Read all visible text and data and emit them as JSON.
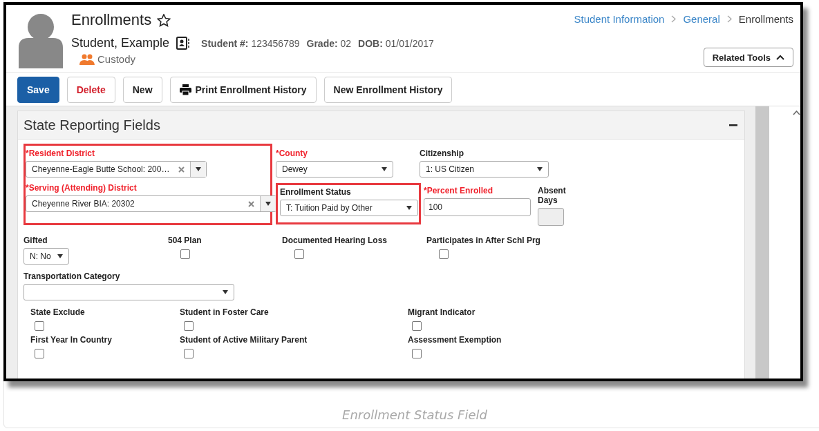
{
  "header": {
    "title": "Enrollments",
    "student_name": "Student, Example",
    "student_number_label": "Student #:",
    "student_number": "123456789",
    "grade_label": "Grade:",
    "grade": "02",
    "dob_label": "DOB:",
    "dob": "01/01/2017",
    "custody": "Custody"
  },
  "breadcrumb": [
    {
      "label": "Student Information",
      "kind": "link"
    },
    {
      "label": "General",
      "kind": "link"
    },
    {
      "label": "Enrollments",
      "kind": "current"
    }
  ],
  "related_tools": {
    "label": "Related Tools",
    "expanded": true
  },
  "toolbar": [
    {
      "label": "Save",
      "kind": "primary"
    },
    {
      "label": "Delete",
      "kind": "danger"
    },
    {
      "label": "New",
      "kind": "plain"
    },
    {
      "label": "Print Enrollment History",
      "kind": "print"
    },
    {
      "label": "New Enrollment History",
      "kind": "plain"
    }
  ],
  "panel": {
    "title": "State Reporting Fields",
    "district_group": {
      "highlighted": true,
      "fields": [
        {
          "label": "*Resident District",
          "required": true,
          "kind": "select",
          "value": "Cheyenne-Eagle Butte School: 200…",
          "clearable": true
        },
        {
          "label": "*Serving (Attending) District",
          "required": true,
          "kind": "select",
          "value": "Cheyenne River BIA: 20302",
          "clearable": true
        }
      ]
    },
    "county": {
      "label": "*County",
      "required": true,
      "kind": "select",
      "value": "Dewey",
      "clearable": false
    },
    "enrollment_status": {
      "label": "Enrollment Status",
      "required": false,
      "kind": "select",
      "value": "T: Tuition Paid by Other",
      "clearable": false,
      "highlighted": true
    },
    "citizenship": {
      "label": "Citizenship",
      "required": false,
      "kind": "select",
      "value": "1: US Citizen",
      "clearable": false
    },
    "percent_enrolled": {
      "label": "*Percent Enrolled",
      "required": true,
      "kind": "text",
      "value": "100",
      "disabled": false
    },
    "absent_days": {
      "label": "Absent Days",
      "required": false,
      "kind": "text",
      "disabled": true
    },
    "row_fields": [
      {
        "label": "Gifted",
        "kind": "select",
        "value": "N: No"
      },
      {
        "label": "504 Plan",
        "kind": "checkbox",
        "checked": false
      },
      {
        "label": "Documented Hearing Loss",
        "kind": "checkbox",
        "checked": false
      },
      {
        "label": "Participates in After Schl Prg",
        "kind": "checkbox",
        "checked": false
      }
    ],
    "transportation_category": {
      "label": "Transportation Category",
      "kind": "select"
    },
    "checkboxes": [
      {
        "label": "State Exclude",
        "checked": false
      },
      {
        "label": "Student in Foster Care",
        "checked": false
      },
      {
        "label": "Migrant Indicator",
        "checked": false
      },
      {
        "label": "First Year In Country",
        "checked": false
      },
      {
        "label": "Student of Active Military Parent",
        "checked": false
      },
      {
        "label": "Assessment Exemption",
        "checked": false
      }
    ]
  },
  "caption": "Enrollment Status Field"
}
